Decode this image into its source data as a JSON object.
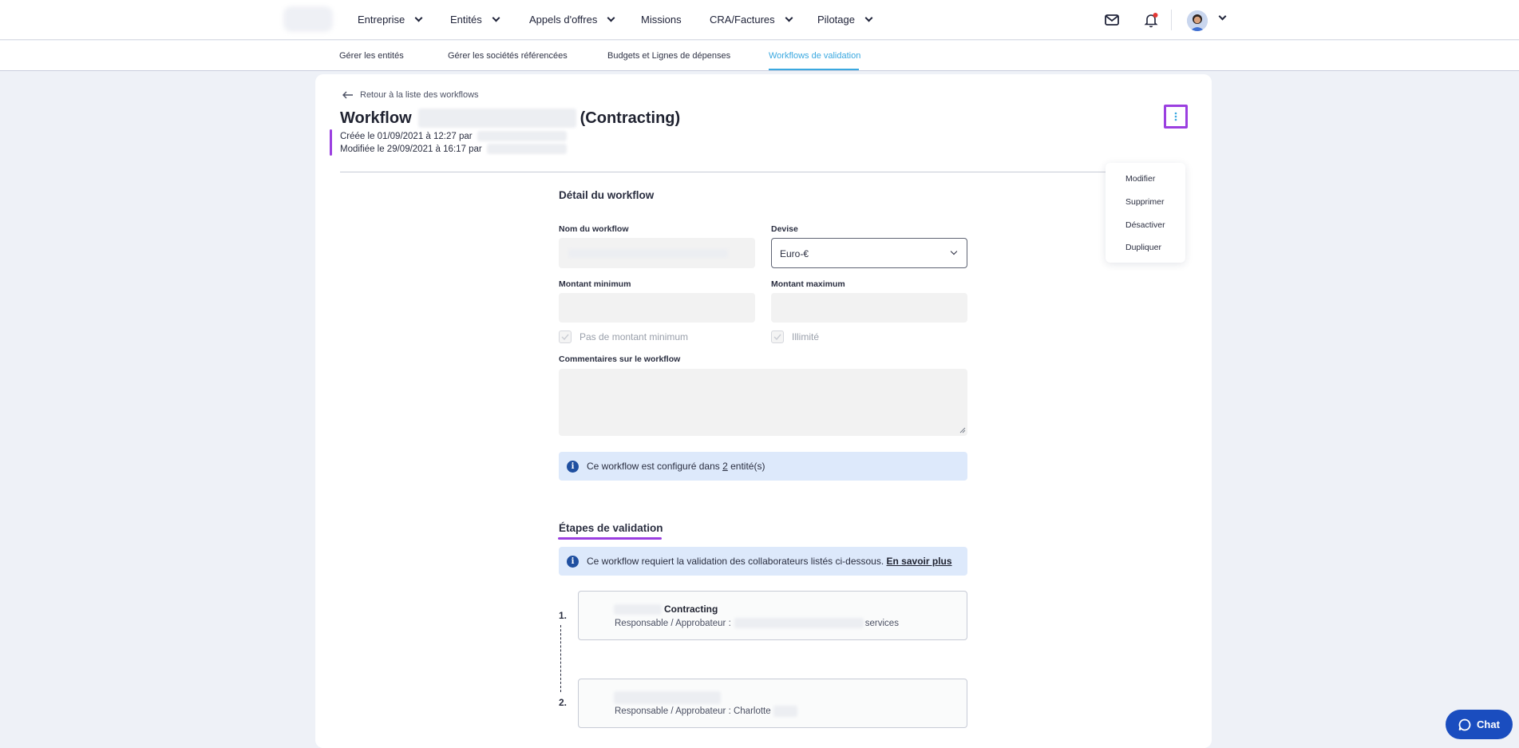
{
  "topnav": {
    "items": [
      {
        "label": "Entreprise"
      },
      {
        "label": "Entités"
      },
      {
        "label": "Appels d'offres"
      },
      {
        "label": "Missions"
      },
      {
        "label": "CRA/Factures"
      },
      {
        "label": "Pilotage"
      }
    ],
    "icons": {
      "mail": "mail-icon",
      "bell": "bell-icon",
      "notification_dot_color": "#e53935"
    }
  },
  "subnav": {
    "tabs": [
      {
        "label": "Gérer les entités"
      },
      {
        "label": "Gérer les sociétés référencées"
      },
      {
        "label": "Budgets et Lignes de dépenses"
      },
      {
        "label": "Workflows de validation",
        "active": true
      }
    ]
  },
  "page": {
    "back_label": "Retour à la liste des workflows",
    "title_prefix": "Workflow",
    "title_suffix": "(Contracting)",
    "created": "Créée le 01/09/2021 à 12:27 par",
    "modified": "Modifiée le 29/09/2021 à 16:17 par"
  },
  "menu": {
    "items": [
      "Modifier",
      "Supprimer",
      "Désactiver",
      "Dupliquer"
    ]
  },
  "detail": {
    "section_title": "Détail du workflow",
    "name_label": "Nom du workflow",
    "currency_label": "Devise",
    "currency_value": "Euro-€",
    "min_label": "Montant minimum",
    "max_label": "Montant maximum",
    "no_min_label": "Pas de montant minimum",
    "unlimited_label": "Illimité",
    "comments_label": "Commentaires sur le workflow",
    "info_prefix": "Ce workflow est configuré dans ",
    "info_count": "2",
    "info_suffix": " entité(s)"
  },
  "steps": {
    "title": "Étapes de validation",
    "info_text": "Ce workflow requiert la validation des collaborateurs listés ci-dessous.",
    "info_link": "En savoir plus",
    "items": [
      {
        "number": "1.",
        "name": "Contracting",
        "resp_label": "Responsable / Approbateur :",
        "resp_value": "services"
      },
      {
        "number": "2.",
        "name": "",
        "resp_label": "Responsable / Approbateur :",
        "resp_value": "Charlotte"
      }
    ]
  },
  "chat": {
    "label": "Chat"
  },
  "colors": {
    "accent": "#9b3fe0",
    "active_tab": "#3aa8e0",
    "chat": "#1a4dbf",
    "info_bg": "#dde9fb"
  }
}
